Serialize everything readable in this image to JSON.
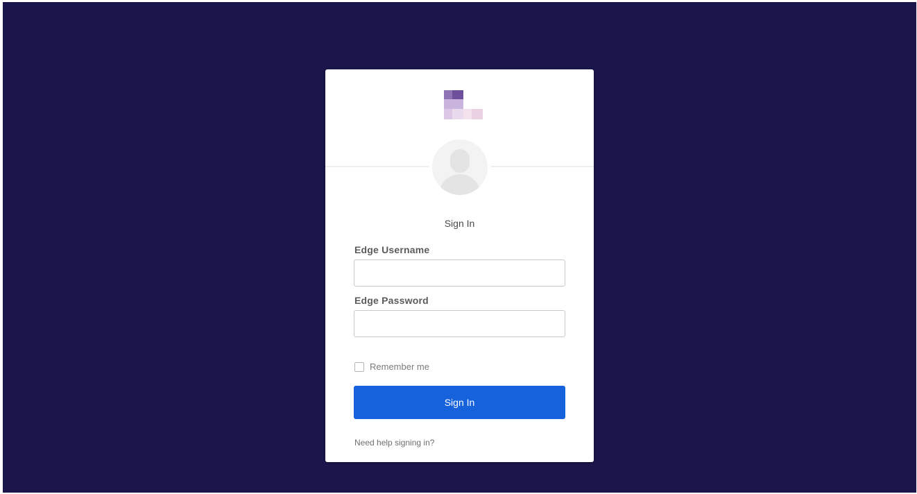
{
  "page": {
    "background_color": "#1a164b",
    "accent_color": "#1662dd"
  },
  "logo": {
    "icon": "company-logo-pixelated"
  },
  "avatar": {
    "icon": "user-avatar-placeholder-icon"
  },
  "form": {
    "title": "Sign In",
    "username_label": "Edge Username",
    "username_value": "",
    "password_label": "Edge Password",
    "password_value": "",
    "remember_label": "Remember me",
    "remember_checked": false,
    "submit_label": "Sign In",
    "help_link": "Need help signing in?"
  }
}
